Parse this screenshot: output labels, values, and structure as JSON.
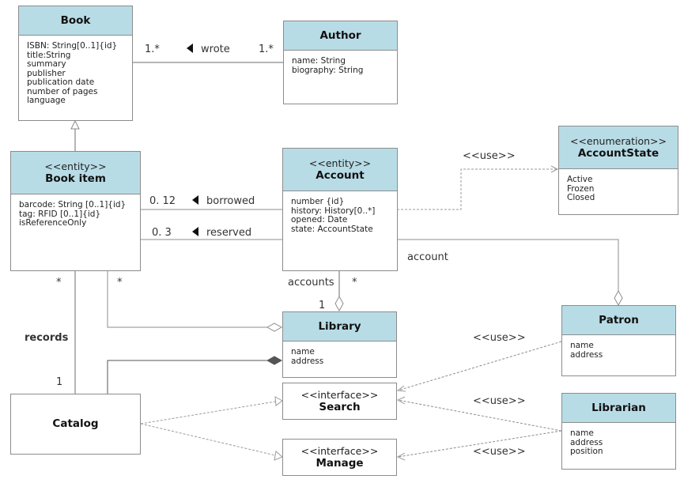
{
  "classes": {
    "book": {
      "name": "Book",
      "attributes": [
        "ISBN: String[0..1]{id}",
        "title:String",
        "summary",
        "publisher",
        "publication date",
        "number of pages",
        "language"
      ]
    },
    "author": {
      "name": "Author",
      "attributes": [
        "name: String",
        "biography: String"
      ]
    },
    "book_item": {
      "stereotype": "<<entity>>",
      "name": "Book item",
      "attributes": [
        "barcode: String [0..1]{id}",
        "tag: RFID [0..1]{id}",
        "isReferenceOnly"
      ]
    },
    "account": {
      "stereotype": "<<entity>>",
      "name": "Account",
      "attributes": [
        "number {id}",
        "history: History[0..*]",
        "opened: Date",
        "state: AccountState"
      ]
    },
    "account_state": {
      "stereotype": "<<enumeration>>",
      "name": "AccountState",
      "attributes": [
        "Active",
        "Frozen",
        "Closed"
      ]
    },
    "library": {
      "name": "Library",
      "attributes": [
        "name",
        "address"
      ]
    },
    "patron": {
      "name": "Patron",
      "attributes": [
        "name",
        "address"
      ]
    },
    "librarian": {
      "name": "Librarian",
      "attributes": [
        "name",
        "address",
        "position"
      ]
    },
    "catalog": {
      "name": "Catalog"
    },
    "search": {
      "stereotype": "<<interface>>",
      "name": "Search"
    },
    "manage": {
      "stereotype": "<<interface>>",
      "name": "Manage"
    }
  },
  "labels": {
    "wrote": "wrote",
    "wrote_mult_left": "1.*",
    "wrote_mult_right": "1.*",
    "borrowed": "borrowed",
    "borrowed_mult": "0. 12",
    "reserved": "reserved",
    "reserved_mult": "0. 3",
    "use_account_state": "<<use>>",
    "account": "account",
    "accounts": "accounts",
    "accounts_mult_star": "*",
    "accounts_mult_one": "1",
    "bookitem_catalog_star": "*",
    "bookitem_library_star": "*",
    "records": "records",
    "records_mult_one": "1",
    "use_patron_search": "<<use>>",
    "use_librarian_search": "<<use>>",
    "use_librarian_manage": "<<use>>"
  },
  "colors": {
    "class_header": "#b8dce6",
    "border": "#8c8c8c",
    "line": "#6e6e6e",
    "dashed": "#9a9a9a"
  }
}
